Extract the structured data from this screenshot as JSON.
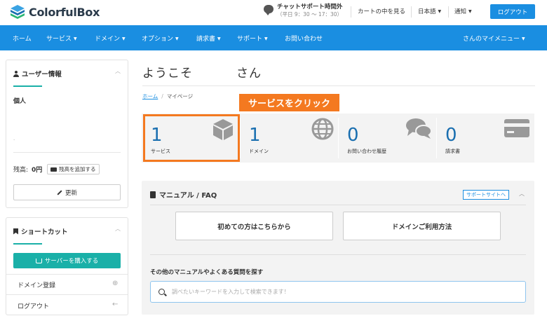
{
  "brand": {
    "name": "ColorfulBox"
  },
  "header": {
    "support_title": "チャットサポート時間外",
    "support_hours": "（平日 9：30 〜 17：30）",
    "cart_link": "カートの中を見る",
    "language": "日本語",
    "notifications": "通知",
    "logout": "ログアウト"
  },
  "nav": {
    "items": [
      {
        "label": "ホーム"
      },
      {
        "label": "サービス",
        "dropdown": true
      },
      {
        "label": "ドメイン",
        "dropdown": true
      },
      {
        "label": "オプション",
        "dropdown": true
      },
      {
        "label": "請求書",
        "dropdown": true
      },
      {
        "label": "サポート",
        "dropdown": true
      },
      {
        "label": "お問い合わせ"
      }
    ],
    "my_menu": "さんのマイメニュー"
  },
  "user_card": {
    "title": "ユーザー情報",
    "account_type": "個人",
    "dot": ".",
    "balance_label": "残高:",
    "balance_value": "0円",
    "add_balance_button": "残高を追加する",
    "update_button": "更新"
  },
  "shortcut_card": {
    "title": "ショートカット",
    "buy_server_button": "サーバーを購入する",
    "items": [
      {
        "label": "ドメイン登録",
        "icon": "globe-icon"
      },
      {
        "label": "ログアウト",
        "icon": "arrow-left-icon"
      }
    ]
  },
  "main": {
    "welcome_prefix": "ようこそ",
    "welcome_suffix": "さん",
    "breadcrumb": {
      "home": "ホーム",
      "separator": "/",
      "current": "マイページ"
    },
    "callout": "サービスをクリック",
    "stats": [
      {
        "count": "1",
        "label": "サービス",
        "icon": "cube-icon"
      },
      {
        "count": "1",
        "label": "ドメイン",
        "icon": "globe-icon"
      },
      {
        "count": "0",
        "label": "お問い合わせ履歴",
        "icon": "chat-bubbles-icon"
      },
      {
        "count": "0",
        "label": "請求書",
        "icon": "credit-card-icon"
      }
    ]
  },
  "manual": {
    "title": "マニュアル / FAQ",
    "support_site_link": "サポートサイトへ",
    "beginners_button": "初めての方はこちらから",
    "domain_guide_button": "ドメインご利用方法",
    "faq_label": "その他のマニュアルやよくある質問を探す",
    "search_placeholder": "調べたいキーワードを入力して検索できます！"
  },
  "colors": {
    "primary": "#1a8ee1",
    "teal": "#1ab0a8",
    "highlight_orange": "#f47920",
    "stat_number": "#1a6fb0"
  }
}
